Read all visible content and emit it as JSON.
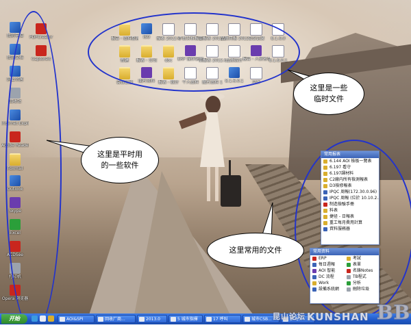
{
  "annotations": {
    "software_note": "这里是平时用的一些软件",
    "temp_files_note": "这里是一些临时文件",
    "common_files_note": "这里常用的文件"
  },
  "left_icons": [
    {
      "label": "我的电脑",
      "kind": "sys"
    },
    {
      "label": "我的文档",
      "kind": "sys"
    },
    {
      "label": "网上邻居",
      "kind": "sys"
    },
    {
      "label": "回收站",
      "kind": "gray"
    },
    {
      "label": "Internet Explorer",
      "kind": "sys"
    },
    {
      "label": "Adobe Reader 9",
      "kind": "red"
    },
    {
      "label": "Foxmail",
      "kind": "folder"
    },
    {
      "label": "Outlook",
      "kind": "sys"
    },
    {
      "label": "Skype",
      "kind": "purple"
    },
    {
      "label": "Excel",
      "kind": "green"
    },
    {
      "label": "ACDSee",
      "kind": "red"
    },
    {
      "label": "打印机",
      "kind": "gray"
    },
    {
      "label": "Opera 浏览器",
      "kind": "red"
    }
  ],
  "left_icons_col2": [
    {
      "label": "PDFCreator",
      "kind": "red"
    },
    {
      "label": "CaptureIt",
      "kind": "red"
    }
  ],
  "temp_files": [
    {
      "label": "报告 - 资料整理",
      "kind": "folder"
    },
    {
      "label": "ISO",
      "kind": "sys"
    },
    {
      "label": "报表 2012.6",
      "kind": "doc"
    },
    {
      "label": "不良分析报告",
      "kind": "doc"
    },
    {
      "label": "周报表 2012.5",
      "kind": "doc"
    },
    {
      "label": "品质月报 2012.5",
      "kind": "doc"
    },
    {
      "label": "会议记录",
      "kind": "doc"
    },
    {
      "label": "8.1.6.0",
      "kind": "doc"
    },
    {
      "label": "新建",
      "kind": "folder"
    },
    {
      "label": "报表 - 公司",
      "kind": "folder"
    },
    {
      "label": "doc",
      "kind": "folder"
    },
    {
      "label": "ERP 操作说明",
      "kind": "purple"
    },
    {
      "label": "周报表 2012.6",
      "kind": "doc"
    },
    {
      "label": "品质统计",
      "kind": "doc"
    },
    {
      "label": "报告 - 人员名单",
      "kind": "purple"
    },
    {
      "label": "8.1.6.0.1",
      "kind": "doc"
    },
    {
      "label": "会议记录",
      "kind": "folder"
    },
    {
      "label": "图片资料",
      "kind": "purple"
    },
    {
      "label": "报表 - 统计",
      "kind": "folder"
    },
    {
      "label": "个人资料",
      "kind": "doc"
    },
    {
      "label": "图片资料 1",
      "kind": "doc"
    },
    {
      "label": "8.1.6.0.1",
      "kind": "sys"
    },
    {
      "label": "文件",
      "kind": "doc"
    }
  ],
  "panel_common": {
    "title": "常用报表",
    "rows": [
      {
        "label": "6.144 AOI 檢板一覽表",
        "color": "#d9ae2e"
      },
      {
        "label": "6.197 看守",
        "color": "#d9ae2e"
      },
      {
        "label": "6.197課材料",
        "color": "#d9ae2e"
      },
      {
        "label": "C2廠内所有檢測報表",
        "color": "#d9ae2e"
      },
      {
        "label": "D3檢修報表",
        "color": "#d9ae2e"
      },
      {
        "label": "IPQC 周報(172.30.0.96)",
        "color": "#3b63b6"
      },
      {
        "label": "IPQC 周報 (位於 10.10.2...",
        "color": "#3b63b6"
      },
      {
        "label": "制造檢驗手冊",
        "color": "#c9261d"
      },
      {
        "label": "料表",
        "color": "#d9ae2e"
      },
      {
        "label": "捷径 - 日報表",
        "color": "#d9ae2e"
      },
      {
        "label": "重工每月費用計算",
        "color": "#d9ae2e"
      },
      {
        "label": "資料服務器",
        "color": "#3b63b6"
      }
    ]
  },
  "panel_tools": {
    "title": "常用资料",
    "rows": [
      {
        "label": "ERP",
        "color": "#c9261d"
      },
      {
        "label": "考試",
        "color": "#d9ae2e"
      },
      {
        "label": "每日週報",
        "color": "#3b63b6"
      },
      {
        "label": "表單",
        "color": "#2b9f3a"
      },
      {
        "label": "AOI 智能",
        "color": "#6a3cae"
      },
      {
        "label": "名錄Notes",
        "color": "#c9261d"
      },
      {
        "label": "DC 流程",
        "color": "#3b63b6"
      },
      {
        "label": "TB程式",
        "color": "#9ca3ad"
      },
      {
        "label": "Work",
        "color": "#d9ae2e"
      },
      {
        "label": "分析",
        "color": "#2b9f3a"
      },
      {
        "label": "設備系統網",
        "color": "#3b63b6"
      },
      {
        "label": "刪除垃圾",
        "color": "#9ca3ad"
      }
    ]
  },
  "taskbar": {
    "start": "开始",
    "tasks": [
      "AOI&SPI",
      "回收厂商...",
      "2013.0",
      "5 城市指揮",
      "17 呼叫",
      "城市CSB...",
      "梦飞..."
    ]
  },
  "watermark": {
    "small": "昆山论坛",
    "main": "KUNSHAN",
    "bbs": "BBS"
  }
}
